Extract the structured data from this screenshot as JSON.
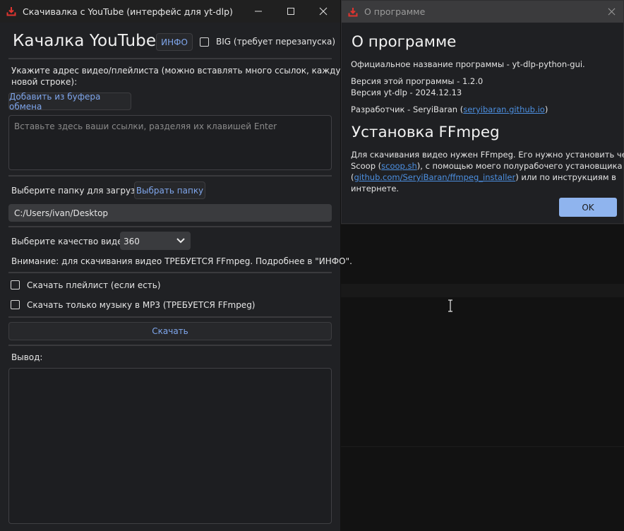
{
  "main_window": {
    "title": "Скачивалка с YouTube (интерфейс для yt-dlp)",
    "app_heading": "Качалка YouTube",
    "info_button": "ИНФО",
    "big_checkbox_label": "BIG (требует перезапуска)",
    "url_instruction_line1": "Укажите адрес видео/плейлиста (можно вставлять много ссылок, каждую на",
    "url_instruction_line2": "новой строке):",
    "paste_button": "Добавить из буфера обмена",
    "links_placeholder": "Вставьте здесь ваши ссылки, разделяя их клавишей Enter",
    "folder_label": "Выберите папку для загрузки:",
    "choose_folder_button": "Выбрать папку",
    "folder_path": "C:/Users/ivan/Desktop",
    "quality_label": "Выберите качество видео:",
    "quality_value": "360",
    "ffmpeg_warning": "Внимание: для скачивания видео ТРЕБУЕТСЯ FFmpeg. Подробнее в \"ИНФО\".",
    "playlist_checkbox_label": "Скачать плейлист (если есть)",
    "mp3_checkbox_label": "Скачать только музыку в MP3 (ТРЕБУЕТСЯ FFmpeg)",
    "download_button": "Скачать",
    "output_label": "Вывод:"
  },
  "about_window": {
    "title": "О программе",
    "heading": "О программе",
    "official_name": "Официальное название программы - yt-dlp-python-gui.",
    "program_version": "Версия этой программы - 1.2.0",
    "ytdlp_version": "Версия yt-dlp - 2024.12.13",
    "developer_prefix": "Разработчик - SeryiBaran (",
    "developer_link": "seryibaran.github.io",
    "developer_suffix": ")",
    "ffmpeg_heading": "Установка FFmpeg",
    "ffmpeg_line1": "Для скачивания видео нужен FFmpeg. Его нужно установить через",
    "ffmpeg_line2_prefix": "Scoop (",
    "scoop_link": "scoop.sh",
    "ffmpeg_line2_suffix": "), с помощью моего полурабочего установщика",
    "ffmpeg_line3_prefix": "(",
    "installer_link": "github.com/SeryiBaran/ffmpeg_installer",
    "ffmpeg_line3_suffix": ") или по инструкциям в",
    "ffmpeg_line4": "интернете.",
    "ok_button": "OK"
  },
  "icons": {
    "app_icon": "download-tray-icon",
    "minimize": "minimize-icon",
    "maximize": "maximize-icon",
    "close": "close-icon",
    "dropdown": "chevron-down-icon",
    "text_cursor": "i-beam-cursor-icon"
  },
  "colors": {
    "accent_link": "#4c8fe0",
    "button_text": "#7fa6ec",
    "ok_button_bg": "#8fb4ee",
    "app_icon_red": "#e0342f"
  }
}
